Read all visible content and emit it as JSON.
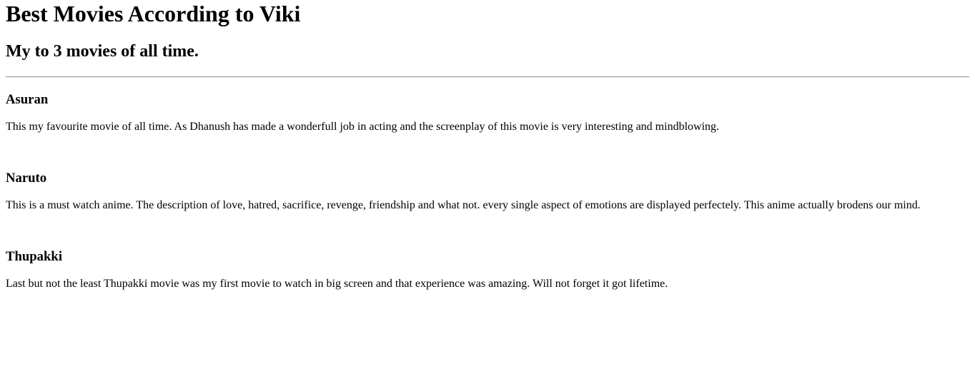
{
  "header": {
    "title": "Best Movies According to Viki",
    "subtitle": "My to 3 movies of all time."
  },
  "movies": [
    {
      "title": "Asuran",
      "description": "This my favourite movie of all time. As Dhanush has made a wonderfull job in acting and the screenplay of this movie is very interesting and mindblowing."
    },
    {
      "title": "Naruto",
      "description": "This is a must watch anime. The description of love, hatred, sacrifice, revenge, friendship and what not. every single aspect of emotions are displayed perfectely. This anime actually brodens our mind."
    },
    {
      "title": "Thupakki",
      "description": "Last but not the least Thupakki movie was my first movie to watch in big screen and that experience was amazing. Will not forget it got lifetime."
    }
  ]
}
